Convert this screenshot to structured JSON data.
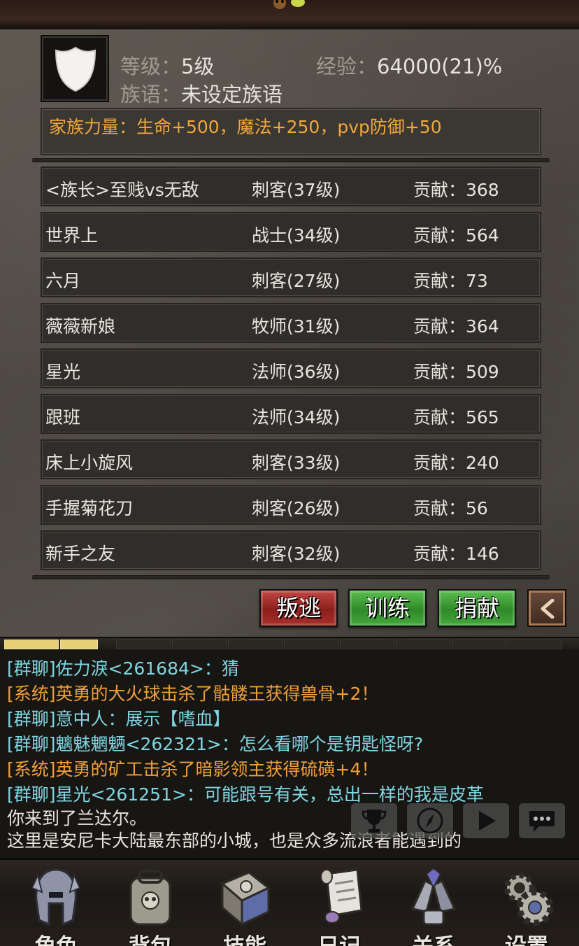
{
  "guild": {
    "level_label": "等级：",
    "level_value": "5级",
    "exp_label": "经验：",
    "exp_value": "64000(21)%",
    "motto_label": "族语：",
    "motto_value": "未设定族语",
    "power": "家族力量：生命+500，魔法+250，pvp防御+50"
  },
  "members": [
    {
      "name": "<族长>至贱vs无敌",
      "cls": "刺客(37级)",
      "contrib": "贡献：368"
    },
    {
      "name": "世界上",
      "cls": "战士(34级)",
      "contrib": "贡献：564"
    },
    {
      "name": "六月",
      "cls": "刺客(27级)",
      "contrib": "贡献：73"
    },
    {
      "name": "薇薇新娘",
      "cls": "牧师(31级)",
      "contrib": "贡献：364"
    },
    {
      "name": "星光",
      "cls": "法师(36级)",
      "contrib": "贡献：509"
    },
    {
      "name": "跟班",
      "cls": "法师(34级)",
      "contrib": "贡献：565"
    },
    {
      "name": "床上小旋风",
      "cls": "刺客(33级)",
      "contrib": "贡献：240"
    },
    {
      "name": "手握菊花刀",
      "cls": "刺客(26级)",
      "contrib": "贡献：56"
    },
    {
      "name": "新手之友",
      "cls": "刺客(32级)",
      "contrib": "贡献：146"
    }
  ],
  "actions": {
    "defect": "叛逃",
    "train": "训练",
    "donate": "捐献",
    "back_icon": "chevron-left-icon"
  },
  "chat": [
    "[群聊]佐力淚<261684>：猜",
    "[系统]英勇的大火球击杀了骷髅王获得兽骨+2！",
    "[群聊]意中人：展示【嗜血】",
    "[群聊]魑魅魍魉<262321>：怎么看哪个是钥匙怪呀?",
    "[系统]英勇的矿工击杀了暗影领主获得硫磺+4！",
    "[群聊]星光<261251>：可能跟号有关，总出一样的我是皮革",
    "你来到了兰达尔。",
    "这里是安尼卡大陆最东部的小城，也是众多流浪者能遇到的"
  ],
  "tools": [
    "trophy-icon",
    "compass-icon",
    "play-icon",
    "more-icon"
  ],
  "nav": {
    "role": "角色",
    "bag": "背包",
    "skill": "技能",
    "diary": "日记",
    "relation": "关系",
    "settings": "设置"
  },
  "colors": {
    "power_text": "#f0a83a",
    "group_chat": "#7fd6e3",
    "system_chat": "#f0a03a",
    "defect_button": "#a8302b",
    "green_button": "#2f8a29"
  }
}
